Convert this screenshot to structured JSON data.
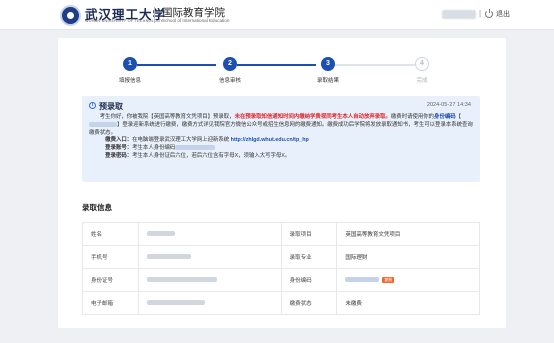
{
  "header": {
    "university_name": "武汉理工大学",
    "university_en": "WUHAN UNIVERSITY OF TECHNOLOGY",
    "school_name": "国际教育学院",
    "school_name_en": "School of International Education",
    "separator": "|",
    "logout_label": "退出",
    "icons": [
      "university-logo",
      "power-icon"
    ]
  },
  "steps": [
    {
      "number": "1",
      "label": "填报信息",
      "status": "done"
    },
    {
      "number": "2",
      "label": "信息审核",
      "status": "done"
    },
    {
      "number": "3",
      "label": "录取结果",
      "status": "done"
    },
    {
      "number": "4",
      "label": "完成",
      "status": "todo"
    }
  ],
  "notice": {
    "title": "预录取",
    "timestamp": "2024-05-27 14:34",
    "p1_a": "考生你好，你被我院【英国高等教育文凭项目】预录取，",
    "p1_red": "未在预录取知信通知时间内缴纳学费视同考生本人自动放弃录取。",
    "p1_b": "缴费时请使用你的",
    "p1_blue": "身份编码",
    "p1_c": "【",
    "p1_d": "】登录迎新系统进行缴费，缴费方式详见我院官方微信公众号或招生信息网的缴费通知。缴费成功后学院将发放录取通知书，考生可以登录本系统查询缴费状态。",
    "line2_label": "缴费入口：",
    "line2_text": "在电脑端登录武汉理工大学网上迎新系统 ",
    "line2_url": "http://zhlgd.whut.edu.cn/tp_hp",
    "line3_label": "登录账号：",
    "line3_text": "考生本人身份编码",
    "line4_label": "登录密码：",
    "line4_text": "考生本人身份证后六位，若后六位含有字母X，须输入大写字母X。"
  },
  "section": {
    "title": "录取信息"
  },
  "table": {
    "rows": [
      {
        "left_key": "姓名",
        "right_key": "录取项目",
        "right_value": "英国高等教育文凭项目"
      },
      {
        "left_key": "手机号",
        "right_key": "录取专业",
        "right_value": "国际理财"
      },
      {
        "left_key": "身份证号",
        "right_key": "身份编码",
        "right_tag": "复制"
      },
      {
        "left_key": "电子邮箱",
        "right_key": "缴费状态",
        "right_value": "未缴费"
      }
    ]
  },
  "colors": {
    "primary": "#1d4fb3",
    "notice_bg": "#e8f0fb",
    "warning_red": "#e0262a",
    "tag_orange": "#ef6a2f"
  }
}
